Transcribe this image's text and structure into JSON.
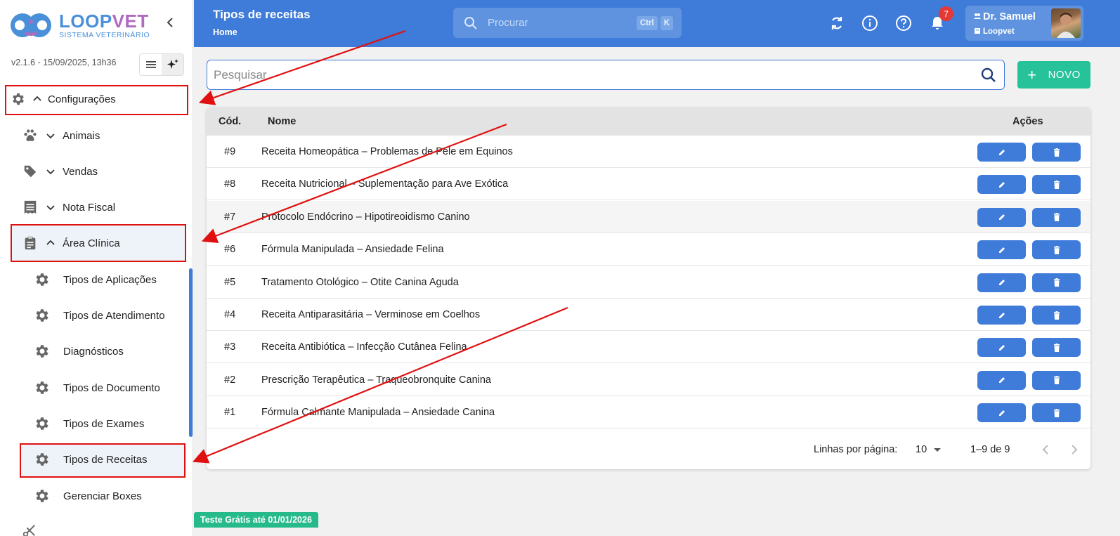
{
  "app": {
    "logo_name_a": "LOOP",
    "logo_name_b": "VET",
    "logo_sub": "SISTEMA VETERINÁRIO",
    "version": "v2.1.6 - 15/09/2025, 13h36",
    "trial": "Teste Grátis até 01/01/2026"
  },
  "sidebar": {
    "items": [
      {
        "label": "Configurações",
        "icon": "gear-icon",
        "expanded": true
      },
      {
        "label": "Animais",
        "icon": "paw-icon",
        "expanded": false
      },
      {
        "label": "Vendas",
        "icon": "tag-icon",
        "expanded": false
      },
      {
        "label": "Nota Fiscal",
        "icon": "receipt-icon",
        "expanded": false
      },
      {
        "label": "Área Clínica",
        "icon": "clipboard-icon",
        "expanded": true
      }
    ],
    "sub_items": [
      {
        "label": "Tipos de Aplicações"
      },
      {
        "label": "Tipos de Atendimento"
      },
      {
        "label": "Diagnósticos"
      },
      {
        "label": "Tipos de Documento"
      },
      {
        "label": "Tipos de Exames"
      },
      {
        "label": "Tipos de Receitas",
        "active": true
      },
      {
        "label": "Gerenciar Boxes"
      }
    ]
  },
  "header": {
    "title": "Tipos de receitas",
    "breadcrumb": "Home",
    "search_placeholder": "Procurar",
    "kbd_ctrl": "Ctrl",
    "kbd_k": "K",
    "notifications": "7",
    "user_name": "Dr. Samuel",
    "user_org": "Loopvet"
  },
  "toolbar": {
    "search_placeholder": "Pesquisar",
    "new_label": "NOVO"
  },
  "table": {
    "headers": {
      "cod": "Cód.",
      "nome": "Nome",
      "acoes": "Ações"
    },
    "rows": [
      {
        "cod": "#9",
        "nome": "Receita Homeopática – Problemas de Pele em Equinos"
      },
      {
        "cod": "#8",
        "nome": "Receita Nutricional – Suplementação para Ave Exótica"
      },
      {
        "cod": "#7",
        "nome": "Protocolo Endócrino – Hipotireoidismo Canino"
      },
      {
        "cod": "#6",
        "nome": "Fórmula Manipulada – Ansiedade Felina"
      },
      {
        "cod": "#5",
        "nome": "Tratamento Otológico – Otite Canina Aguda"
      },
      {
        "cod": "#4",
        "nome": "Receita Antiparasitária – Verminose em Coelhos"
      },
      {
        "cod": "#3",
        "nome": "Receita Antibiótica – Infecção Cutânea Felina"
      },
      {
        "cod": "#2",
        "nome": "Prescrição Terapêutica – Traqueobronquite Canina"
      },
      {
        "cod": "#1",
        "nome": "Fórmula Calmante Manipulada – Ansiedade Canina"
      }
    ],
    "pagination": {
      "rows_label": "Linhas por página:",
      "rows_value": "10",
      "range": "1–9 de 9"
    }
  },
  "colors": {
    "primary": "#3f7bd8",
    "accent_green": "#26c29a",
    "annotation_red": "#e01010"
  }
}
